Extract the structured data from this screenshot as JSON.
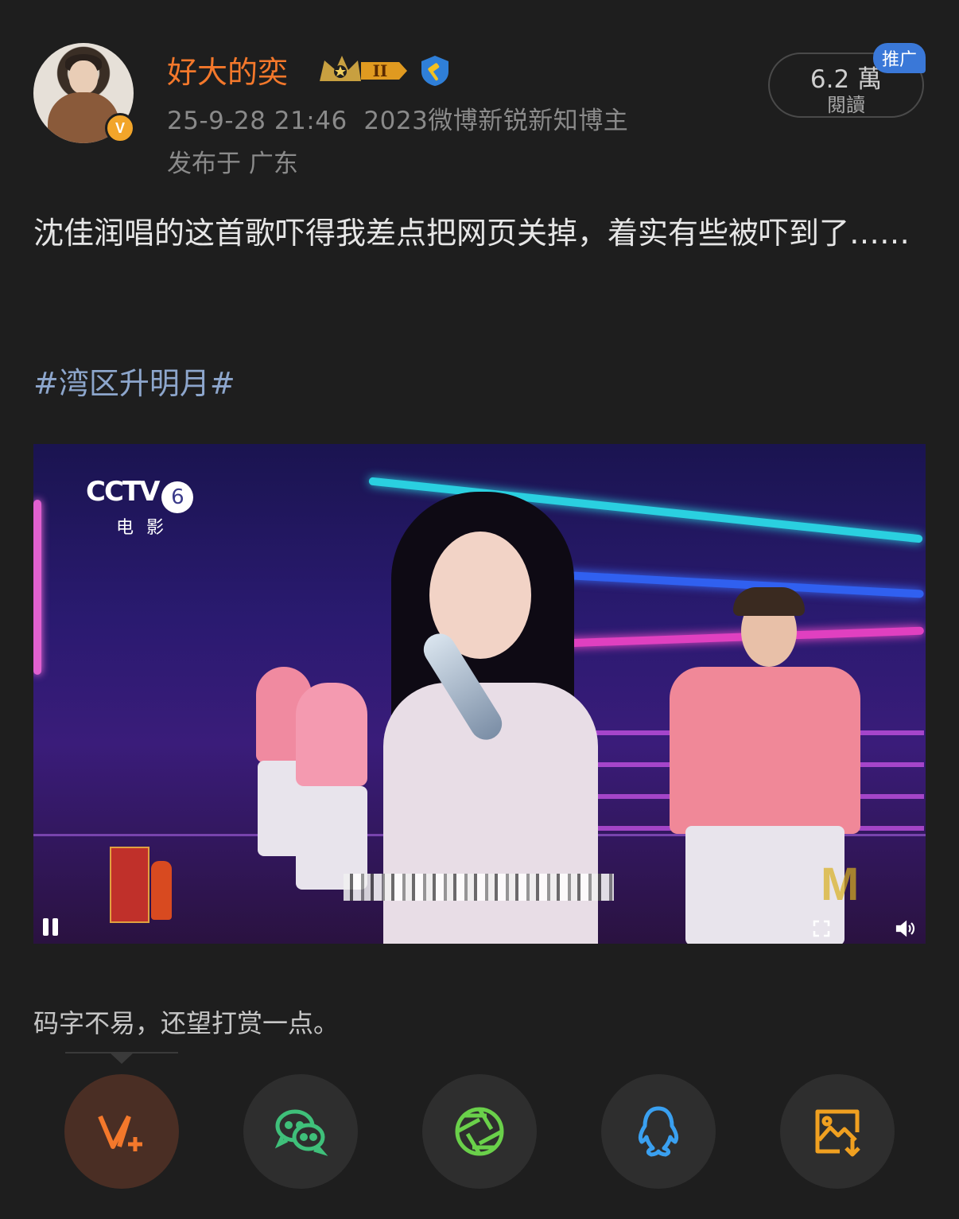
{
  "post": {
    "author": {
      "name": "好大的奕",
      "verified_badge": "V",
      "level_badge": "II",
      "avatar": "avatar-photo"
    },
    "timestamp": "25-9-28 21:46",
    "author_title": "2023微博新锐新知博主",
    "location": "发布于 广东",
    "reads": {
      "count": "6.2 萬",
      "label": "閱讀"
    },
    "promo_label": "推广",
    "text": "沈佳润唱的这首歌吓得我差点把网页关掉，着实有些被吓到了……",
    "hashtag": "#湾区升明月#",
    "video": {
      "channel_logo": "CCTV",
      "channel_number": "6",
      "channel_name": "电影",
      "state": "playing",
      "watermark": "M"
    },
    "tip_text": "码字不易，还望打赏一点。"
  },
  "share_actions": [
    {
      "name": "v-plus",
      "icon": "v-plus-icon",
      "color": "#f4782b",
      "active": true
    },
    {
      "name": "wechat",
      "icon": "wechat-icon",
      "color": "#3fc07a"
    },
    {
      "name": "moments",
      "icon": "moments-aperture-icon",
      "color": "#6ad04a"
    },
    {
      "name": "qq",
      "icon": "qq-penguin-icon",
      "color": "#3aa0f0"
    },
    {
      "name": "save-image",
      "icon": "save-image-icon",
      "color": "#f0a020"
    }
  ],
  "colors": {
    "background": "#1e1e1e",
    "accent": "#f4782b",
    "hashtag": "#8da6cc",
    "meta": "#8a8a8a"
  }
}
